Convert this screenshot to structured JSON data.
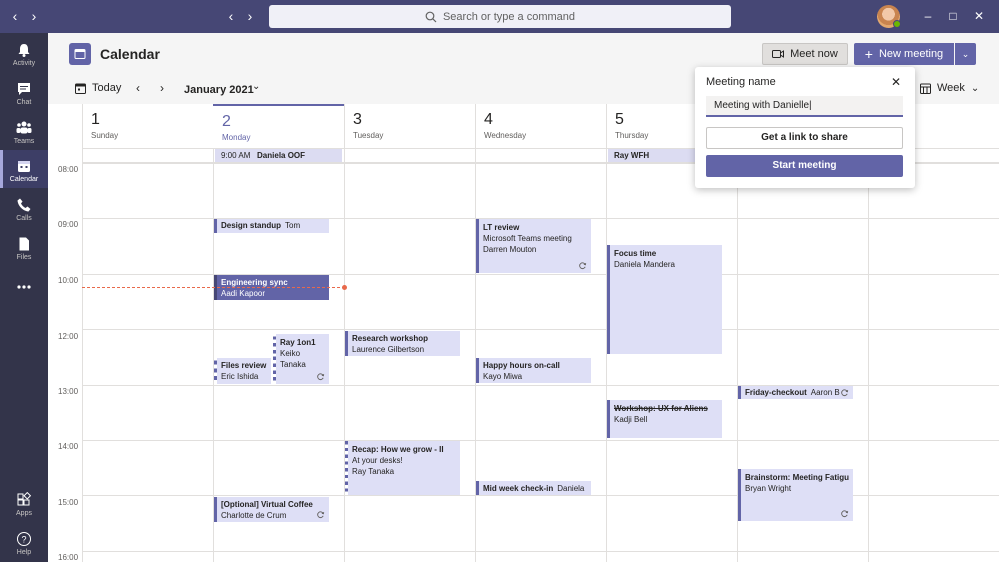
{
  "colors": {
    "titlebar": "#464775",
    "rail": "#33344a",
    "accent": "#6264a7",
    "event_bg": "#dedff6",
    "now_line": "#e8694a"
  },
  "titlebar": {
    "search_placeholder": "Search or type a command",
    "icons": [
      "back-arrow-icon",
      "forward-arrow-icon",
      "search-icon",
      "minimize-icon",
      "maximize-icon",
      "close-icon"
    ]
  },
  "rail": {
    "items": [
      {
        "label": "Activity",
        "icon": "bell-icon"
      },
      {
        "label": "Chat",
        "icon": "chat-icon"
      },
      {
        "label": "Teams",
        "icon": "teams-icon"
      },
      {
        "label": "Calendar",
        "icon": "calendar-icon",
        "active": true
      },
      {
        "label": "Calls",
        "icon": "phone-icon"
      },
      {
        "label": "Files",
        "icon": "file-icon"
      },
      {
        "label": "",
        "icon": "more-icon"
      },
      {
        "label": "Apps",
        "icon": "apps-icon"
      },
      {
        "label": "Help",
        "icon": "help-icon"
      }
    ]
  },
  "header": {
    "title": "Calendar",
    "meet_now": "Meet now",
    "new_meeting": "New meeting",
    "today": "Today",
    "month": "January 2021",
    "view": "Week"
  },
  "days": [
    {
      "num": "1",
      "name": "Sunday"
    },
    {
      "num": "2",
      "name": "Monday",
      "today": true
    },
    {
      "num": "3",
      "name": "Tuesday"
    },
    {
      "num": "4",
      "name": "Wednesday"
    },
    {
      "num": "5",
      "name": "Thursday"
    }
  ],
  "hours": [
    "08:00",
    "09:00",
    "10:00",
    "12:00",
    "13:00",
    "14:00",
    "15:00",
    "16:00"
  ],
  "allday": [
    {
      "time": "9:00 AM",
      "title": "Daniela OOF"
    },
    {
      "title": "Ray WFH"
    }
  ],
  "events": {
    "design_standup": {
      "title": "Design standup",
      "who": "Tom"
    },
    "lt_review": {
      "title": "LT review",
      "line2": "Microsoft Teams meeting",
      "line3": "Darren Mouton"
    },
    "focus_time": {
      "title": "Focus time",
      "line2": "Daniela Mandera"
    },
    "engineering_sync": {
      "title": "Engineering sync",
      "line2": "Aadi Kapoor"
    },
    "ray_1on1": {
      "title": "Ray 1on1",
      "line2": "Keiko Tanaka"
    },
    "files_review": {
      "title": "Files review",
      "line2": "Eric Ishida"
    },
    "research_workshop": {
      "title": "Research workshop",
      "line2": "Laurence Gilbertson"
    },
    "happy_hours": {
      "title": "Happy hours on-call",
      "line2": "Kayo Miwa"
    },
    "friday_checkout": {
      "title": "Friday-checkout",
      "who": "Aaron B"
    },
    "workshop_ux": {
      "title": "Workshop: UX for Aliens",
      "line2": "Kadji Bell"
    },
    "recap": {
      "title": "Recap: How we grow - II",
      "line2": "At your desks!",
      "line3": "Ray Tanaka"
    },
    "brainstorm": {
      "title": "Brainstorm: Meeting Fatigu",
      "line2": "Bryan Wright"
    },
    "mid_week": {
      "title": "Mid week check-in",
      "who": "Daniela"
    },
    "virtual_coffee": {
      "title": "[Optional] Virtual Coffee",
      "line2": "Charlotte de Crum"
    }
  },
  "popover": {
    "title": "Meeting name",
    "input_value": "Meeting with Danielle|",
    "link_button": "Get a link to share",
    "start_button": "Start meeting"
  }
}
